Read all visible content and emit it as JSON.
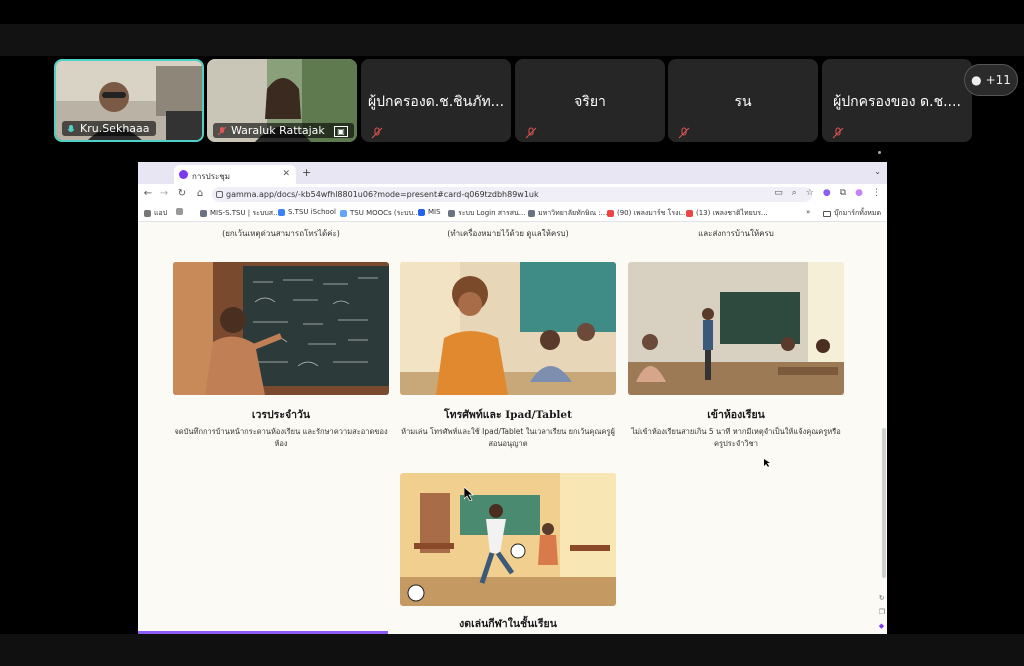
{
  "meeting": {
    "participants": [
      {
        "name": "Kru.Sekhaaa",
        "video": true,
        "active": true
      },
      {
        "name": "Waraluk Rattajak",
        "video": true,
        "active": false
      },
      {
        "name": "ผู้ปกครองด.ช.ชินภัท...",
        "video": false
      },
      {
        "name": "จริยา",
        "video": false
      },
      {
        "name": "รน",
        "video": false
      },
      {
        "name": "ผู้ปกครองของ ด.ช....",
        "video": false
      }
    ],
    "more_count": "+11"
  },
  "browser": {
    "tab_title": "การประชุม",
    "url": "gamma.app/docs/-kb54wfhl8801u06?mode=present#card-q069tzdbh89w1uk",
    "bookmarks": [
      "แอป",
      "MIS-S.TSU | ระบบส...",
      "S.TSU iSchool",
      "TSU MOOCs (ระบบ...",
      "MIS",
      "ระบบ Login สารสน...",
      "มหาวิทยาลัยทักษิณ :...",
      "(90) เพลงมาร์ช โรงเ...",
      "(13) เพลงชาติไทยบร..."
    ],
    "bookmarks_all": "บุ๊กมาร์กทั้งหมด"
  },
  "slide": {
    "cut_texts": [
      "(ยกเว้นเหตุด่วนสามารถโทรได้ค่ะ)",
      "(ทำเครื่องหมายไว้ด้วย ดูแลให้ครบ)",
      "และส่งการบ้านให้ครบ"
    ],
    "cards": [
      {
        "title": "เวรประจำวัน",
        "desc": "จดบันทึกการบ้านหน้ากระดานห้องเรียน และรักษาความสะอาดของห้อง"
      },
      {
        "title": "โทรศัพท์และ Ipad/Tablet",
        "desc": "ห้ามเล่น โทรศัพท์และใช้ Ipad/Tablet ในเวลาเรียน ยกเว้นคุณครูผู้สอนอนุญาต"
      },
      {
        "title": "เข้าห้องเรียน",
        "desc": "ไม่เข้าห้องเรียนสายเกิน 5 นาที หากมีเหตุจำเป็นให้แจ้งคุณครูหรือครูประจำวิชา"
      },
      {
        "title": "งดเล่นกีฬาในชั้นเรียน",
        "desc": ""
      }
    ]
  },
  "colors": {
    "accent": "#4fd1c5",
    "mute": "#e05555",
    "brand": "#7c3aed"
  }
}
